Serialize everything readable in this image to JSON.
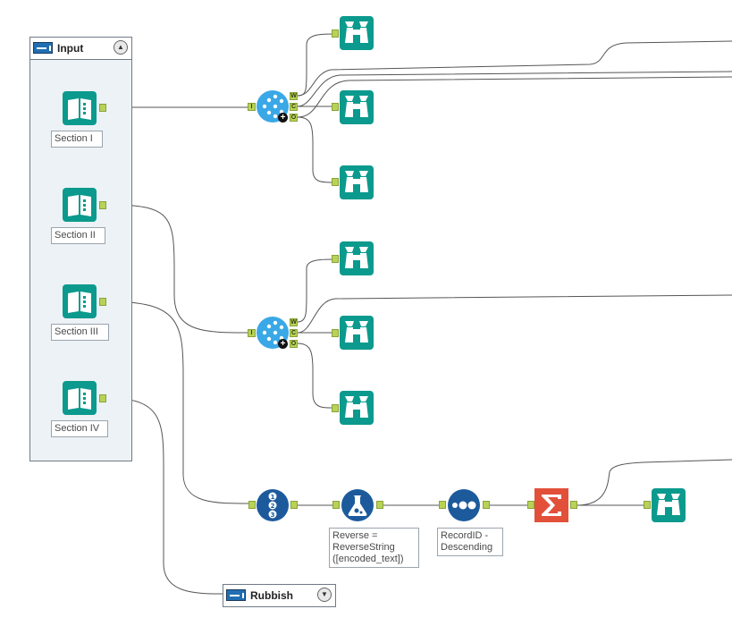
{
  "colors": {
    "teal": "#0b9a8d",
    "blue_light": "#3aa8e6",
    "blue_dark": "#1c5a9c",
    "sum_red": "#e2503a",
    "anchor_green": "#b8d257",
    "wire": "#555555",
    "container_border": "#707b86",
    "container_bg": "#edf2f6"
  },
  "containers": {
    "input": {
      "title": "Input"
    },
    "rubbish": {
      "title": "Rubbish"
    }
  },
  "inputs": [
    {
      "label": "Section I",
      "icon": "book-icon"
    },
    {
      "label": "Section II",
      "icon": "book-icon"
    },
    {
      "label": "Section III",
      "icon": "book-icon"
    },
    {
      "label": "Section IV",
      "icon": "book-icon"
    }
  ],
  "join_anchors": {
    "input": "I",
    "out_w": "W",
    "out_c": "C",
    "out_o": "O"
  },
  "formula": {
    "label": "Reverse =\nReverseString\n([encoded_text])",
    "icon": "formula-flask-icon"
  },
  "recordid": {
    "label": "RecordID -\nDescending",
    "icon": "recordid-dots-icon"
  },
  "summarize": {
    "icon": "sigma-icon"
  },
  "browse": {
    "icon": "binoculars-icon"
  },
  "tile": {
    "icon": "tile-123-icon"
  }
}
